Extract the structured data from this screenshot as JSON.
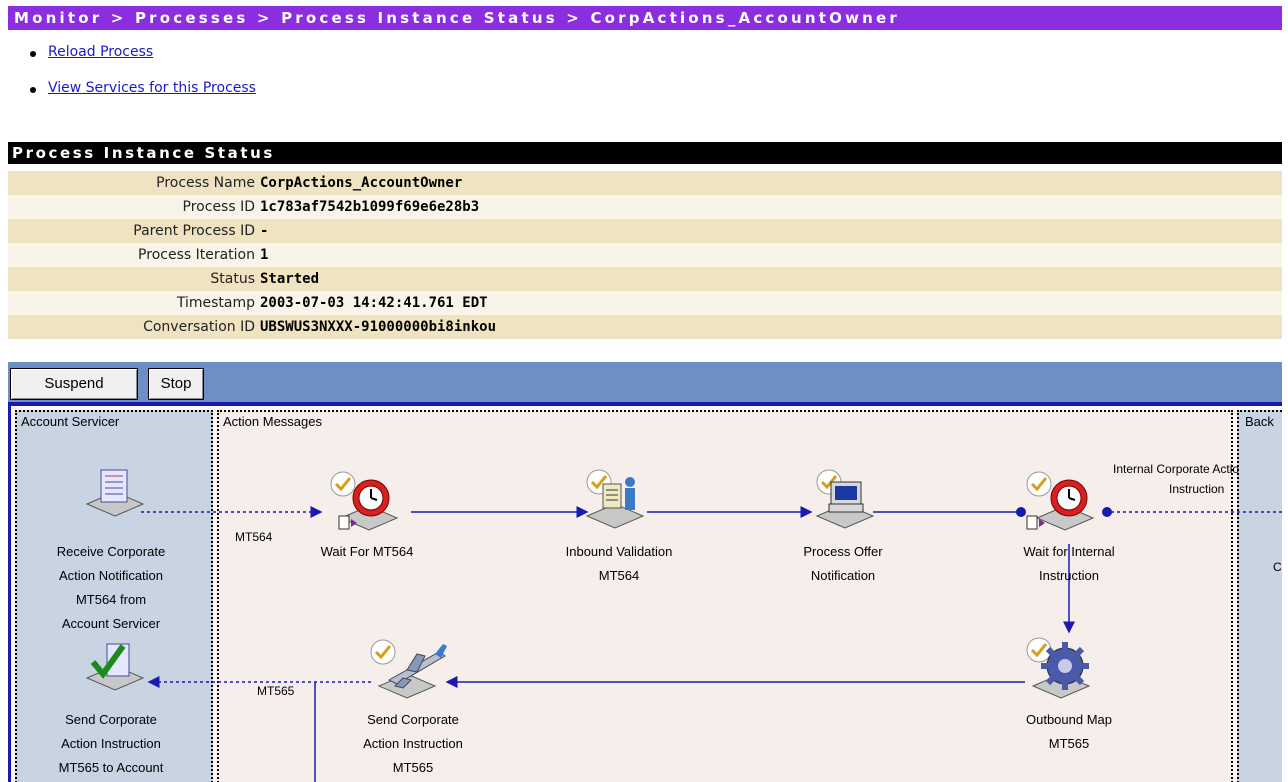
{
  "breadcrumb": "Monitor > Processes > Process Instance Status > CorpActions_AccountOwner",
  "links": [
    "Reload Process",
    "View Services for this Process"
  ],
  "section_title": "Process Instance Status",
  "fields": [
    {
      "label": "Process Name",
      "value": "CorpActions_AccountOwner"
    },
    {
      "label": "Process ID",
      "value": "1c783af7542b1099f69e6e28b3"
    },
    {
      "label": "Parent Process ID",
      "value": "-"
    },
    {
      "label": "Process Iteration",
      "value": "1"
    },
    {
      "label": "Status",
      "value": "Started"
    },
    {
      "label": "Timestamp",
      "value": "2003-07-03 14:42:41.761 EDT"
    },
    {
      "label": "Conversation ID",
      "value": "UBSWUS3NXXX-91000000bi8inkou"
    }
  ],
  "buttons": {
    "suspend": "Suspend",
    "stop": "Stop"
  },
  "diagram": {
    "lanes": {
      "account_servicer": "Account Servicer",
      "action_messages": "Action Messages",
      "back": "Back"
    },
    "nodes": {
      "receive": [
        "Receive Corporate",
        "Action Notification",
        "MT564 from",
        "Account Servicer"
      ],
      "wait_mt564": [
        "Wait For MT564"
      ],
      "inbound": [
        "Inbound Validation",
        "MT564"
      ],
      "process_offer": [
        "Process Offer",
        "Notification"
      ],
      "wait_internal": [
        "Wait for Internal",
        "Instruction"
      ],
      "outbound": [
        "Outbound Map",
        "MT565"
      ],
      "send_mid": [
        "Send Corporate",
        "Action Instruction",
        "MT565"
      ],
      "send_left": [
        "Send Corporate",
        "Action Instruction",
        "MT565 to Account"
      ]
    },
    "edge_labels": {
      "mt564": "MT564",
      "mt565": "MT565",
      "internal_1": "Internal Corporate Actio",
      "internal_2": "Instruction",
      "back_c": "C"
    }
  },
  "colors": {
    "breadcrumb_bg": "#8a2ee0",
    "button_bar": "#6e8fc4",
    "row_dark": "#efe3c2",
    "row_light": "#faf4e8",
    "connector": "#1a1ab0"
  }
}
